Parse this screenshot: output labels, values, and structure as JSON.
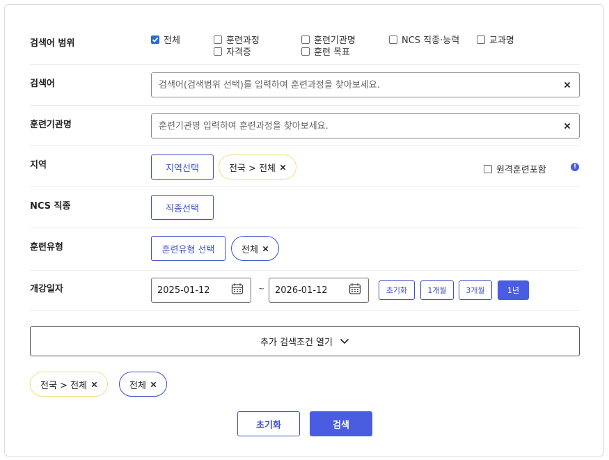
{
  "scope": {
    "label": "검색어 범위",
    "options": [
      {
        "label": "전체",
        "checked": true
      },
      {
        "label": "훈련과정",
        "checked": false
      },
      {
        "label": "자격증",
        "checked": false
      },
      {
        "label": "훈련기관명",
        "checked": false
      },
      {
        "label": "훈련 목표",
        "checked": false
      },
      {
        "label": "NCS 직종·능력",
        "checked": false
      },
      {
        "label": "교과명",
        "checked": false
      }
    ]
  },
  "keyword": {
    "label": "검색어",
    "placeholder": "검색어(검색범위 선택)를 입력하여 훈련과정을 찾아보세요.",
    "value": ""
  },
  "institution": {
    "label": "훈련기관명",
    "placeholder": "훈련기관명 입력하여 훈련과정을 찾아보세요.",
    "value": ""
  },
  "region": {
    "label": "지역",
    "select_label": "지역선택",
    "chip_label": "전국 > 전체",
    "remote_label": "원격훈련포함",
    "remote_checked": false,
    "info_glyph": "!"
  },
  "ncs": {
    "label": "NCS 직종",
    "select_label": "직종선택"
  },
  "training_type": {
    "label": "훈련유형",
    "select_label": "훈련유형 선택",
    "chip_label": "전체"
  },
  "start_date": {
    "label": "개강일자",
    "from": "2025-01-12",
    "separator": "~",
    "to": "2026-01-12",
    "presets": [
      {
        "label": "초기화",
        "active": false
      },
      {
        "label": "1개월",
        "active": false
      },
      {
        "label": "3개월",
        "active": false
      },
      {
        "label": "1년",
        "active": true
      }
    ]
  },
  "expand_label": "추가 검색조건 열기",
  "selected_chips": [
    {
      "label": "전국 > 전체",
      "style": "yellow"
    },
    {
      "label": "전체",
      "style": "blue"
    }
  ],
  "actions": {
    "reset_label": "초기화",
    "search_label": "검색"
  },
  "colors": {
    "accent": "#4a5de0",
    "outline": "#3d50c4",
    "checked": "#2a6bd6",
    "chip_yellow_border": "#f0e08a"
  }
}
